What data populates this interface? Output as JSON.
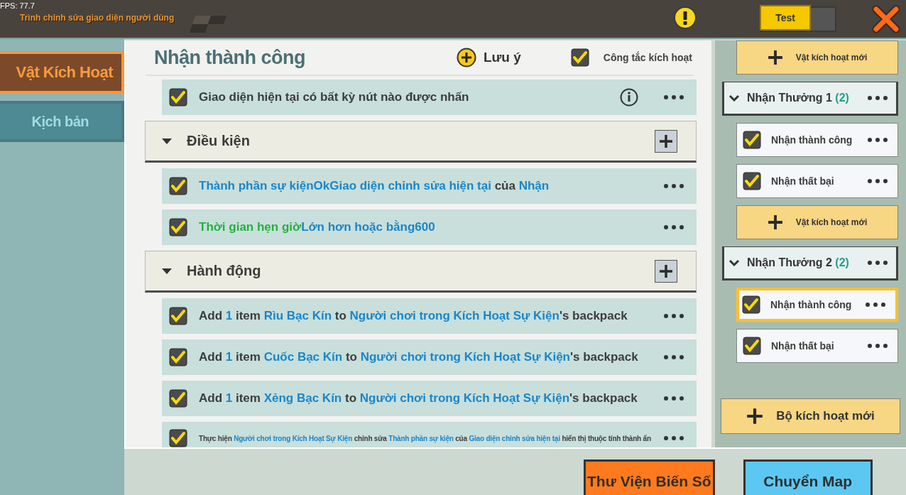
{
  "top_bar": {
    "fps": "FPS: 77.7",
    "subtitle": "Trình chỉnh sửa giao diện người dùng",
    "test_toggle": {
      "label": "Test",
      "on": true
    }
  },
  "sidebar": {
    "tabs": [
      {
        "label": "Vật Kích Hoạt",
        "selected": true
      },
      {
        "label": "Kịch bản",
        "selected": false
      }
    ]
  },
  "editor": {
    "title": "Nhận thành công",
    "note_button": "Lưu ý",
    "switch": {
      "label": "Công tắc kích hoạt",
      "checked": true
    },
    "rows": [
      {
        "kind": "rule",
        "checked": true,
        "small": false,
        "info": true,
        "segments": [
          {
            "kind": "text",
            "text": "Giao diện hiện tại có bất kỳ nút nào được nhấn"
          }
        ]
      },
      {
        "kind": "section",
        "label": "Điều kiện",
        "expanded": true
      },
      {
        "kind": "rule",
        "checked": true,
        "small": false,
        "info": false,
        "segments": [
          {
            "kind": "value",
            "text": "Thành phần sự kiệnOkGiao diện chỉnh sửa hiện tại"
          },
          {
            "kind": "text",
            "text": " của "
          },
          {
            "kind": "value",
            "text": "Nhận"
          }
        ]
      },
      {
        "kind": "rule",
        "checked": true,
        "small": false,
        "info": false,
        "segments": [
          {
            "kind": "time",
            "text": "Thời gian hẹn giờ"
          },
          {
            "kind": "value",
            "text": "Lớn hơn hoặc bằng600"
          }
        ]
      },
      {
        "kind": "section",
        "label": "Hành động",
        "expanded": true
      },
      {
        "kind": "rule",
        "checked": true,
        "small": false,
        "info": false,
        "segments": [
          {
            "kind": "text",
            "text": "Add "
          },
          {
            "kind": "value",
            "text": "1"
          },
          {
            "kind": "text",
            "text": " item "
          },
          {
            "kind": "value",
            "text": "Rìu Bạc Kín"
          },
          {
            "kind": "text",
            "text": " to "
          },
          {
            "kind": "value",
            "text": "Người chơi trong Kích Hoạt Sự Kiện"
          },
          {
            "kind": "text",
            "text": "'s backpack"
          }
        ]
      },
      {
        "kind": "rule",
        "checked": true,
        "small": false,
        "info": false,
        "segments": [
          {
            "kind": "text",
            "text": "Add "
          },
          {
            "kind": "value",
            "text": "1"
          },
          {
            "kind": "text",
            "text": " item "
          },
          {
            "kind": "value",
            "text": "Cuốc Bạc Kín"
          },
          {
            "kind": "text",
            "text": " to "
          },
          {
            "kind": "value",
            "text": "Người chơi trong Kích Hoạt Sự Kiện"
          },
          {
            "kind": "text",
            "text": "'s backpack"
          }
        ]
      },
      {
        "kind": "rule",
        "checked": true,
        "small": false,
        "info": false,
        "segments": [
          {
            "kind": "text",
            "text": "Add "
          },
          {
            "kind": "value",
            "text": "1"
          },
          {
            "kind": "text",
            "text": " item "
          },
          {
            "kind": "value",
            "text": "Xẻng Bạc Kín"
          },
          {
            "kind": "text",
            "text": " to "
          },
          {
            "kind": "value",
            "text": "Người chơi trong Kích Hoạt Sự Kiện"
          },
          {
            "kind": "text",
            "text": "'s backpack"
          }
        ]
      },
      {
        "kind": "rule",
        "checked": true,
        "small": true,
        "info": false,
        "segments": [
          {
            "kind": "text",
            "text": "Thực hiện "
          },
          {
            "kind": "value",
            "text": "Người chơi trong Kích Hoạt Sự Kiện"
          },
          {
            "kind": "text",
            "text": " chỉnh sửa "
          },
          {
            "kind": "value",
            "text": "Thành phần sự kiện"
          },
          {
            "kind": "text",
            "text": " của "
          },
          {
            "kind": "value",
            "text": "Giao diện chỉnh sửa hiện tại"
          },
          {
            "kind": "text",
            "text": " hiển thị thuộc tính thành ẩn"
          }
        ]
      }
    ]
  },
  "triggers": {
    "items": [
      {
        "kind": "add",
        "label": "Vật kích hoạt mới"
      },
      {
        "kind": "group",
        "name": "Nhận Thưởng 1",
        "count": "(2)",
        "expanded": true
      },
      {
        "kind": "item",
        "label": "Nhận thành công",
        "checked": true,
        "selected": false
      },
      {
        "kind": "item",
        "label": "Nhận thất bại",
        "checked": true,
        "selected": false
      },
      {
        "kind": "add",
        "label": "Vật kích hoạt mới"
      },
      {
        "kind": "group",
        "name": "Nhận Thưởng 2",
        "count": "(2)",
        "expanded": true
      },
      {
        "kind": "item",
        "label": "Nhận thành công",
        "checked": true,
        "selected": true
      },
      {
        "kind": "item",
        "label": "Nhận thất bại",
        "checked": true,
        "selected": false
      }
    ],
    "new_button": "Bộ kích hoạt mới"
  },
  "bottom_buttons": [
    {
      "kind": "orange",
      "label": "Thư Viện Biến Số"
    },
    {
      "kind": "blue",
      "label": "Chuyển Map"
    }
  ]
}
